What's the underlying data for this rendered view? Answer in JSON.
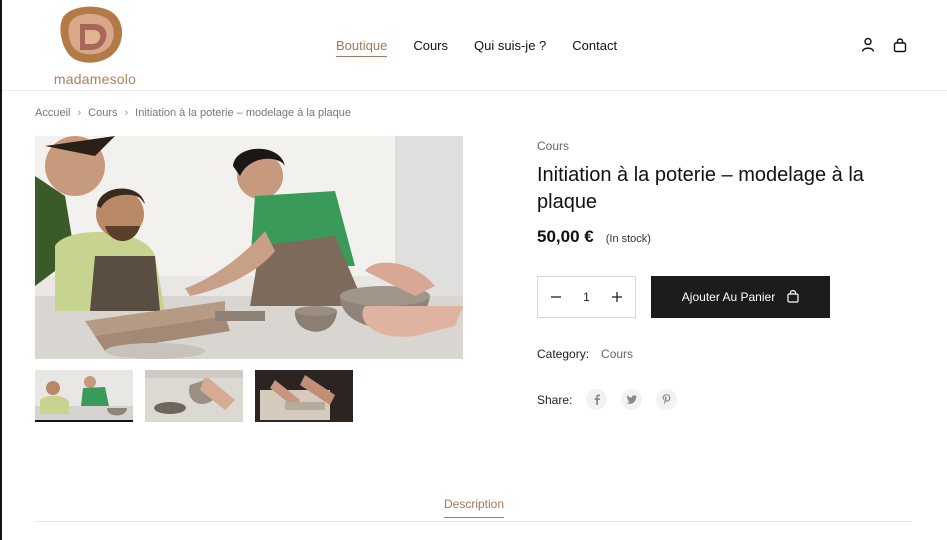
{
  "brand": {
    "name": "madamesolo",
    "accent": "#a4785a",
    "logo_color": "#b37f5a"
  },
  "nav": {
    "items": [
      {
        "label": "Boutique",
        "active": true
      },
      {
        "label": "Cours"
      },
      {
        "label": "Qui suis-je ?"
      },
      {
        "label": "Contact"
      }
    ],
    "icons": [
      "user-icon",
      "shopping-bag-icon"
    ]
  },
  "breadcrumb": [
    "Accueil",
    "Cours",
    "Initiation à la poterie – modelage à la plaque"
  ],
  "product": {
    "category_label": "Cours",
    "title": "Initiation à la poterie – modelage à la plaque",
    "price": "50,00 €",
    "stock": "(In stock)",
    "quantity": "1",
    "add_to_cart": "Ajouter Au Panier",
    "meta_category_label": "Category:",
    "meta_category_value": "Cours",
    "share_label": "Share:",
    "share_icons": [
      "facebook-icon",
      "twitter-icon",
      "pinterest-icon"
    ]
  },
  "tabs": [
    "Description"
  ],
  "colors": {
    "button_bg": "#1c1c1c",
    "border": "#d8d8d8"
  }
}
